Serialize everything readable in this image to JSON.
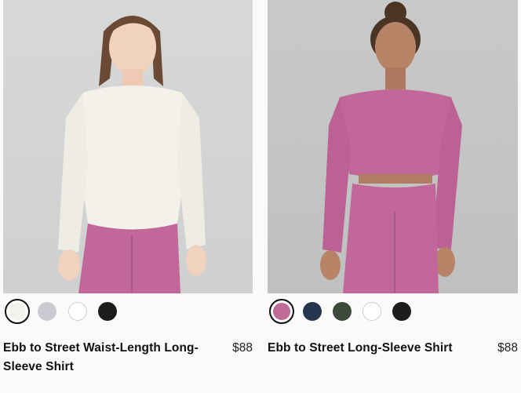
{
  "products": [
    {
      "name": "Ebb to Street Waist-Length Long-Sleeve Shirt",
      "price": "$88",
      "swatches": [
        {
          "color": "#f4f2ec",
          "selected": true
        },
        {
          "color": "#c9cad2",
          "selected": false
        },
        {
          "color": "#ffffff",
          "selected": false
        },
        {
          "color": "#1c1c1c",
          "selected": false
        }
      ]
    },
    {
      "name": "Ebb to Street Long-Sleeve Shirt",
      "price": "$88",
      "swatches": [
        {
          "color": "#c06a98",
          "selected": true
        },
        {
          "color": "#26354f",
          "selected": false
        },
        {
          "color": "#3d4a3b",
          "selected": false
        },
        {
          "color": "#ffffff",
          "selected": false
        },
        {
          "color": "#1c1c1c",
          "selected": false
        }
      ]
    }
  ]
}
